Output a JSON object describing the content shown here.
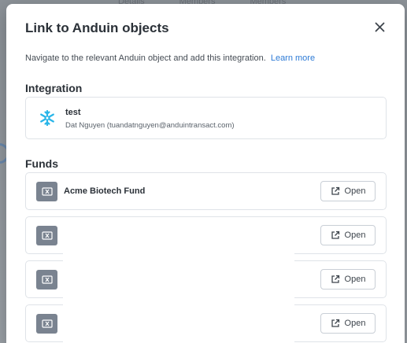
{
  "backdrop": {
    "tabs": [
      "Details",
      "Members",
      "Members"
    ]
  },
  "modal": {
    "title": "Link to Anduin objects",
    "close_icon": "close-icon",
    "description": "Navigate to the relevant Anduin object and add this integration.",
    "learn_more": "Learn more"
  },
  "integration": {
    "section_title": "Integration",
    "icon": "snowflake-icon",
    "name": "test",
    "user": "Dat Nguyen (tuandatnguyen@anduintransact.com)"
  },
  "funds": {
    "section_title": "Funds",
    "items": [
      {
        "name": "Acme Biotech Fund",
        "open_label": "Open"
      },
      {
        "name": "",
        "open_label": "Open"
      },
      {
        "name": "",
        "open_label": "Open"
      },
      {
        "name": "",
        "open_label": "Open"
      }
    ]
  },
  "colors": {
    "accent": "#2e7bd6",
    "snowflake": "#29b5e8",
    "fund_icon_bg": "#7a8390"
  }
}
